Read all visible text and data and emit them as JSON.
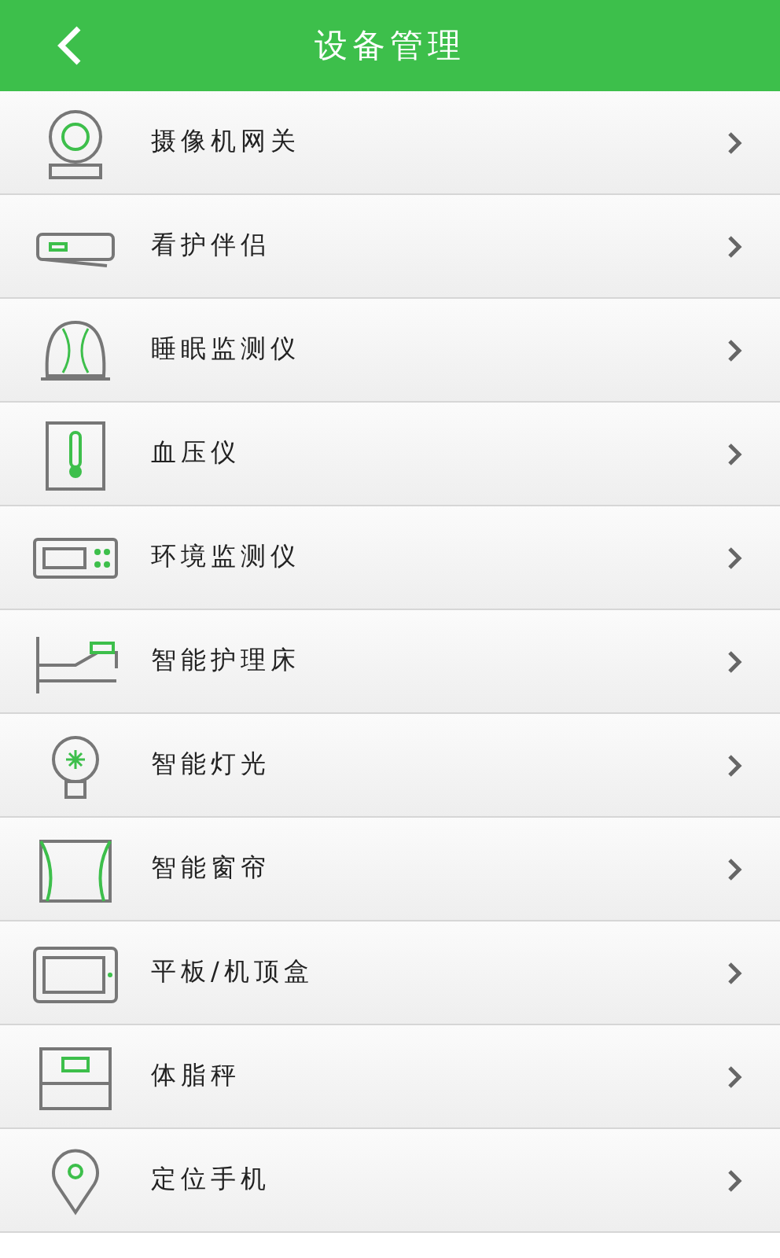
{
  "header": {
    "title": "设备管理"
  },
  "devices": [
    {
      "label": "摄像机网关",
      "kind": "camera"
    },
    {
      "label": "看护伴侣",
      "kind": "companion"
    },
    {
      "label": "睡眠监测仪",
      "kind": "sleep"
    },
    {
      "label": "血压仪",
      "kind": "thermo"
    },
    {
      "label": "环境监测仪",
      "kind": "env"
    },
    {
      "label": "智能护理床",
      "kind": "bed"
    },
    {
      "label": "智能灯光",
      "kind": "bulb"
    },
    {
      "label": "智能窗帘",
      "kind": "curtain"
    },
    {
      "label": "平板/机顶盒",
      "kind": "tablet"
    },
    {
      "label": "体脂秤",
      "kind": "scale"
    },
    {
      "label": "定位手机",
      "kind": "pin"
    }
  ]
}
